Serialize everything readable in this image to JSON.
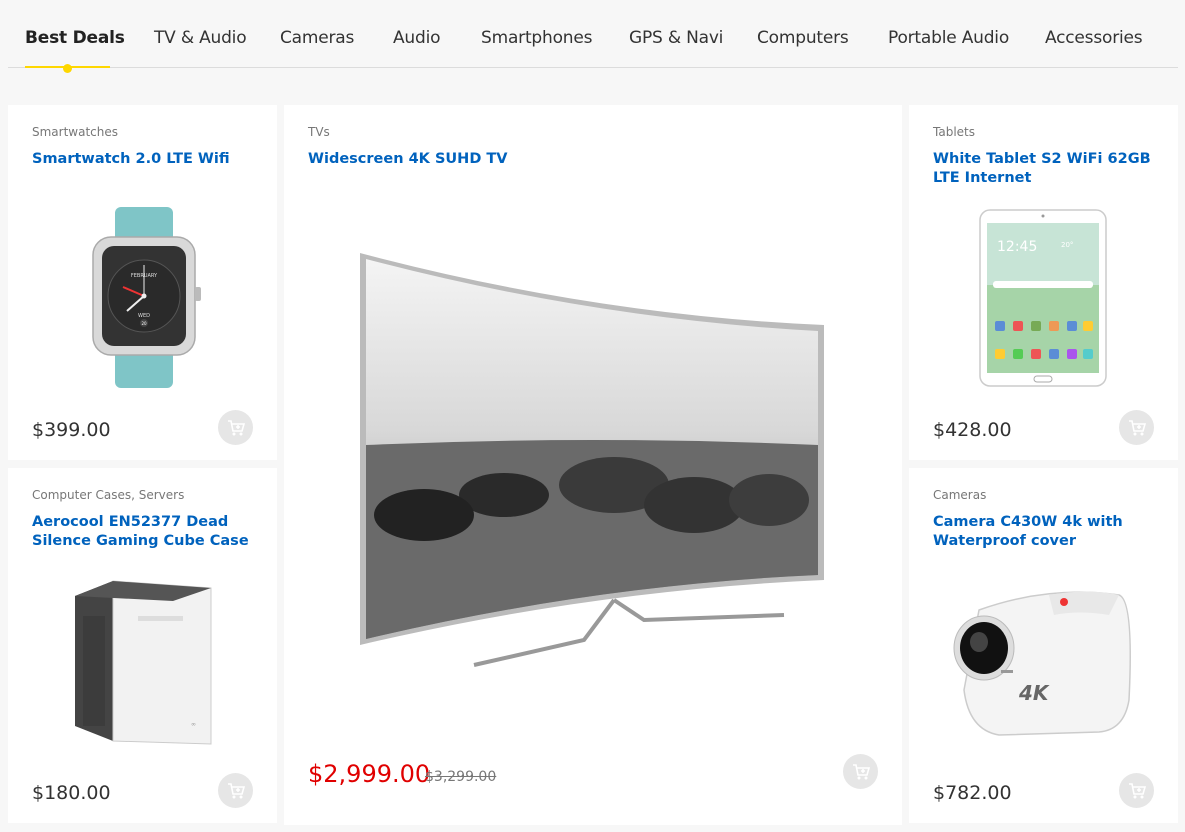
{
  "tabs": [
    {
      "label": "Best Deals",
      "active": true
    },
    {
      "label": "TV & Audio"
    },
    {
      "label": "Cameras"
    },
    {
      "label": "Audio"
    },
    {
      "label": "Smartphones"
    },
    {
      "label": "GPS & Navi"
    },
    {
      "label": "Computers"
    },
    {
      "label": "Portable Audio"
    },
    {
      "label": "Accessories"
    }
  ],
  "accent_color": "#fed700",
  "link_color": "#0062bd",
  "sale_color": "#e00000",
  "products": {
    "smartwatch": {
      "category": "Smartwatches",
      "title": "Smartwatch 2.0 LTE Wifi",
      "price": "$399.00",
      "icon": "smartwatch-image"
    },
    "case": {
      "category": "Computer Cases, Servers",
      "title": "Aerocool EN52377 Dead Silence Gaming Cube Case",
      "price": "$180.00",
      "icon": "pc-case-image"
    },
    "tv": {
      "category": "TVs",
      "title": "Widescreen 4K SUHD TV",
      "sale_price": "$2,999.00",
      "old_price": "$3,299.00",
      "icon": "curved-tv-image"
    },
    "tablet": {
      "category": "Tablets",
      "title": "White Tablet S2 WiFi 62GB LTE Internet",
      "price": "$428.00",
      "icon": "tablet-image"
    },
    "camera": {
      "category": "Cameras",
      "title": "Camera C430W 4k with Waterproof cover",
      "price": "$782.00",
      "icon": "action-camera-image"
    }
  },
  "cart_icon": "add-to-cart-icon",
  "watch_face": {
    "month": "FEBRUARY",
    "day": "WED",
    "date": "20"
  },
  "tablet_screen": {
    "time": "12:45",
    "temp": "20°"
  },
  "camera_label": "4K"
}
